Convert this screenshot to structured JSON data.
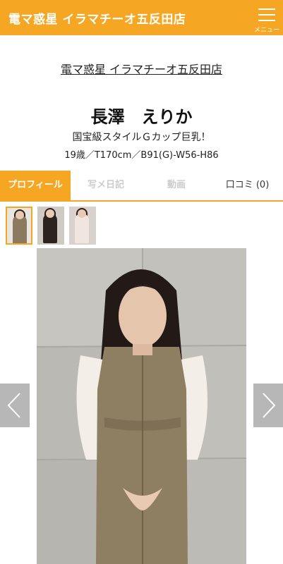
{
  "header": {
    "title": "電マ惑星 イラマチーオ五反田店",
    "menu_label": "メニュー"
  },
  "shop_link": "電マ惑星 イラマチーオ五反田店",
  "profile": {
    "name": "長澤　えりか",
    "catch_copy": "国宝級スタイルＧカップ巨乳！",
    "specs": "19歳／T170cm／B91(G)-W56-H86"
  },
  "tabs": [
    {
      "label": "プロフィール"
    },
    {
      "label": "写メ日記"
    },
    {
      "label": "動画"
    },
    {
      "label": "口コミ (0)"
    }
  ],
  "colors": {
    "accent": "#f5a623",
    "nav_arrow": "#aaaaaa"
  },
  "icons": {
    "menu": "hamburger-icon",
    "prev": "chevron-left-icon",
    "next": "chevron-right-icon"
  }
}
